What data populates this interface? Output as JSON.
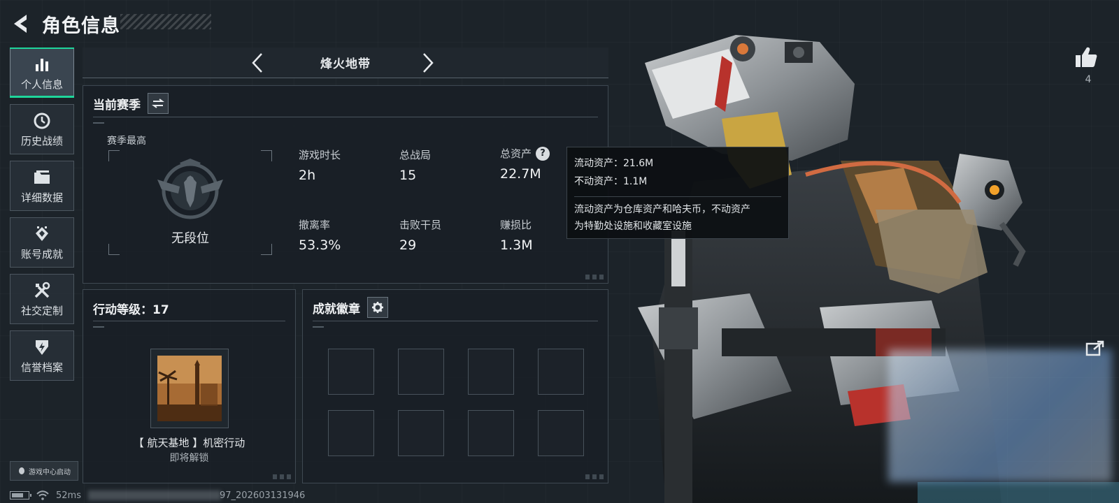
{
  "header": {
    "title": "角色信息"
  },
  "sidebar": {
    "items": [
      {
        "label": "个人信息",
        "icon": "bar-chart-icon",
        "active": true
      },
      {
        "label": "历史战绩",
        "icon": "history-clock-icon",
        "active": false
      },
      {
        "label": "详细数据",
        "icon": "folder-icon",
        "active": false
      },
      {
        "label": "账号成就",
        "icon": "achievement-icon",
        "active": false
      },
      {
        "label": "社交定制",
        "icon": "tools-icon",
        "active": false
      },
      {
        "label": "信誉档案",
        "icon": "shield-bolt-icon",
        "active": false
      }
    ],
    "launch_badge": "游戏中心启动"
  },
  "mode": {
    "title": "烽火地带"
  },
  "season": {
    "title": "当前赛季",
    "best_label": "赛季最高",
    "rank": "无段位",
    "stats": [
      {
        "label": "游戏时长",
        "value": "2h"
      },
      {
        "label": "总战局",
        "value": "15"
      },
      {
        "label": "总资产",
        "value": "22.7M",
        "help": "?"
      },
      {
        "label": "撤离率",
        "value": "53.3%"
      },
      {
        "label": "击败干员",
        "value": "29"
      },
      {
        "label": "赚损比",
        "value": "1.3M"
      }
    ]
  },
  "tooltip": {
    "liquid": "流动资产：21.6M",
    "fixed": "不动资产：1.1M",
    "note_line1": "流动资产为仓库资产和哈夫币，不动资产",
    "note_line2": "为特勤处设施和收藏室设施"
  },
  "level": {
    "title": "行动等级：17",
    "operation_name": "【 航天基地 】机密行动",
    "operation_status": "即将解锁"
  },
  "badges": {
    "title": "成就徽章",
    "slot_count": 8
  },
  "character": {
    "likes": "4"
  },
  "status": {
    "ping": "52ms",
    "uid_suffix": "97_202603131946"
  },
  "colors": {
    "accent": "#1ed69b",
    "tooltip_bg": "#0c0f12",
    "panel_border": "#3f4952"
  }
}
